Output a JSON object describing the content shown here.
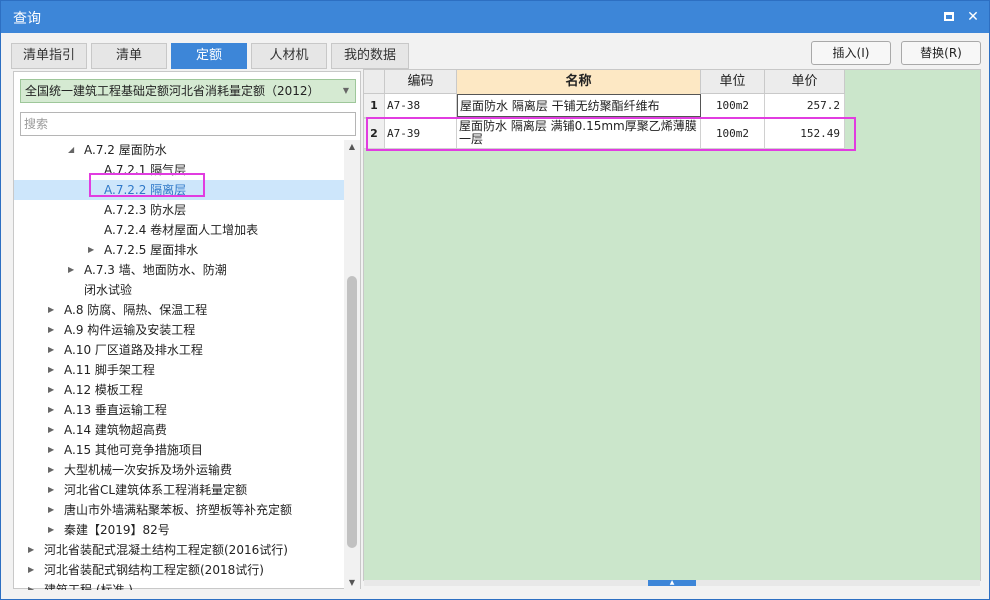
{
  "window": {
    "title": "查询",
    "maximize_icon": "maximize-icon",
    "close_icon": "close-icon",
    "close_glyph": "✕"
  },
  "tabs": [
    {
      "label": "清单指引",
      "active": false
    },
    {
      "label": "清单",
      "active": false
    },
    {
      "label": "定额",
      "active": true
    },
    {
      "label": "人材机",
      "active": false
    },
    {
      "label": "我的数据",
      "active": false
    }
  ],
  "actions": {
    "insert_label": "插入(I)",
    "replace_label": "替换(R)"
  },
  "left": {
    "library_select": "全国统一建筑工程基础定额河北省消耗量定额（2012）",
    "search_placeholder": "搜索",
    "tree": [
      {
        "label": "A.7.2 屋面防水",
        "caret": "◢"
      },
      {
        "label": "A.7.2.1 隔气层",
        "caret": ""
      },
      {
        "label": "A.7.2.2 隔离层",
        "caret": "",
        "selected": true
      },
      {
        "label": "A.7.2.3 防水层",
        "caret": ""
      },
      {
        "label": "A.7.2.4 卷材屋面人工增加表",
        "caret": ""
      },
      {
        "label": "A.7.2.5 屋面排水",
        "caret": "▶"
      },
      {
        "label": "A.7.3 墙、地面防水、防潮",
        "caret": "▶"
      },
      {
        "label": "闭水试验",
        "caret": ""
      },
      {
        "label": "A.8 防腐、隔热、保温工程",
        "caret": "▶"
      },
      {
        "label": "A.9 构件运输及安装工程",
        "caret": "▶"
      },
      {
        "label": "A.10 厂区道路及排水工程",
        "caret": "▶"
      },
      {
        "label": "A.11 脚手架工程",
        "caret": "▶"
      },
      {
        "label": "A.12 模板工程",
        "caret": "▶"
      },
      {
        "label": "A.13 垂直运输工程",
        "caret": "▶"
      },
      {
        "label": "A.14 建筑物超高费",
        "caret": "▶"
      },
      {
        "label": "A.15 其他可竞争措施项目",
        "caret": "▶"
      },
      {
        "label": "大型机械一次安拆及场外运输费",
        "caret": "▶"
      },
      {
        "label": "河北省CL建筑体系工程消耗量定额",
        "caret": "▶"
      },
      {
        "label": "唐山市外墙满粘聚苯板、挤塑板等补充定额",
        "caret": "▶"
      },
      {
        "label": "秦建【2019】82号",
        "caret": "▶"
      },
      {
        "label": "河北省装配式混凝土结构工程定额(2016试行)",
        "caret": "▶"
      },
      {
        "label": "河北省装配式钢结构工程定额(2018试行)",
        "caret": "▶"
      },
      {
        "label": "建筑工程 (标准 )",
        "caret": "▶"
      }
    ],
    "scroll_up": "▲",
    "scroll_down": "▼"
  },
  "grid": {
    "headers": {
      "code": "编码",
      "name": "名称",
      "unit": "单位",
      "price": "单价"
    },
    "rows": [
      {
        "num": "1",
        "code": "A7-38",
        "name": "屋面防水 隔离层 干铺无纺聚酯纤维布",
        "unit": "100m2",
        "price": "257.2"
      },
      {
        "num": "2",
        "code": "A7-39",
        "name": "屋面防水 隔离层 满铺0.15mm厚聚乙烯薄膜一层",
        "unit": "100m2",
        "price": "152.49"
      }
    ],
    "scroll_grip": "▲"
  },
  "colors": {
    "accent": "#3d86d8",
    "highlight": "#e13ce0",
    "grid_bg": "#cbe6cb"
  }
}
